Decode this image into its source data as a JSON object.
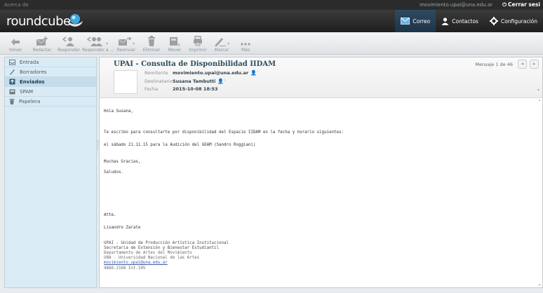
{
  "topbar": {
    "about": "Acerca de",
    "user": "movimiento.upai@una.edu.ar",
    "logout": "Cerrar sesi"
  },
  "header": {
    "logo": "roundcube",
    "nav": [
      {
        "label": "Correo",
        "icon": "mail-icon",
        "active": true
      },
      {
        "label": "Contactos",
        "icon": "contacts-icon",
        "active": false
      },
      {
        "label": "Configuración",
        "icon": "gear-icon",
        "active": false
      }
    ]
  },
  "toolbar": [
    {
      "label": "Volver",
      "icon": "back-arrow-icon"
    },
    {
      "label": "Redactar",
      "icon": "compose-icon"
    },
    {
      "label": "Responder",
      "icon": "reply-icon"
    },
    {
      "label": "Responder a ...",
      "icon": "reply-all-icon"
    },
    {
      "label": "Reenviar",
      "icon": "forward-icon"
    },
    {
      "label": "Eliminar",
      "icon": "trash-icon"
    },
    {
      "label": "Mover",
      "icon": "move-icon"
    },
    {
      "label": "Imprimir",
      "icon": "print-icon"
    },
    {
      "label": "Marcar",
      "icon": "mark-icon"
    },
    {
      "label": "Más",
      "icon": "more-icon"
    }
  ],
  "folders": [
    {
      "label": "Entrada",
      "icon": "inbox-icon",
      "active": false
    },
    {
      "label": "Borradores",
      "icon": "drafts-icon",
      "active": false
    },
    {
      "label": "Enviados",
      "icon": "sent-icon",
      "active": true
    },
    {
      "label": "SPAM",
      "icon": "spam-icon",
      "active": false
    },
    {
      "label": "Papelera",
      "icon": "trash-icon",
      "active": false
    }
  ],
  "message": {
    "subject": "UPAI - Consulta de Disponibilidad IIDAM",
    "from_label": "Remitente",
    "from": "movimiento.upai@una.edu.ar",
    "to_label": "Destinatario",
    "to": "Susana Tambutti",
    "date_label": "Fecha",
    "date": "2015-10-08 18:53",
    "counter": "Mensaje 1 de 46",
    "body": {
      "greeting": "Hola Susana,",
      "line1": "Te escribo para consultarte por disponibilidad del Espacio IIDAM en la fecha y horario siguientes:",
      "line2": "el sábado 21.11.15 para la Audición del GEAM (Sandro Roggiani)",
      "thanks": "Muchas Gracias,",
      "regards": "Saludos.",
      "atte": "Atte.",
      "name": "Lisandro Zarate",
      "sig1": "UPAI - Unidad de Producción Artística Institucional",
      "sig2": "Secretaria de Extensión y Bienestar Estudiantil",
      "sig3": "Departamento de Artes del Movimiento",
      "sig4": "UNA - Universidad Nacional de las Artes",
      "sig5": "movimiento.upai@una.edu.ar",
      "sig6": "4866-2168 Int.105"
    }
  }
}
